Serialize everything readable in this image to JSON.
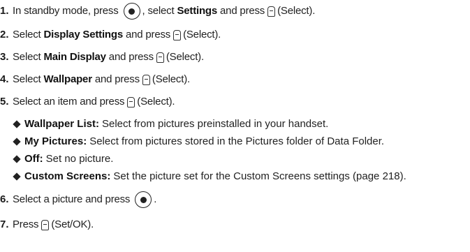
{
  "steps": [
    {
      "number": "1.",
      "t1": "In standby mode, press",
      "t2": ", select",
      "b1": "Settings",
      "t3": "and press",
      "t4": "(Select)."
    },
    {
      "number": "2.",
      "t1": "Select",
      "b1": "Display Settings",
      "t2": "and press",
      "t3": "(Select)."
    },
    {
      "number": "3.",
      "t1": "Select",
      "b1": "Main Display",
      "t2": "and press",
      "t3": "(Select)."
    },
    {
      "number": "4.",
      "t1": "Select",
      "b1": "Wallpaper",
      "t2": "and press",
      "t3": "(Select)."
    },
    {
      "number": "5.",
      "t1": "Select an item and press",
      "t2": "(Select)."
    },
    {
      "number": "6.",
      "t1": "Select a picture and press",
      "t2": "."
    },
    {
      "number": "7.",
      "t1": "Press",
      "t2": "(Set/OK)."
    }
  ],
  "bullets": [
    {
      "label": "Wallpaper List:",
      "text": "Select from pictures preinstalled in your handset."
    },
    {
      "label": "My Pictures:",
      "text": "Select from pictures stored in the Pictures folder of Data Folder."
    },
    {
      "label": "Off:",
      "text": "Set no picture."
    },
    {
      "label": "Custom Screens:",
      "text": "Set the picture set for the Custom Screens settings (page 218)."
    }
  ],
  "icons": {
    "center_key": "center-select-key-icon",
    "soft_key": "left-softkey-icon"
  }
}
